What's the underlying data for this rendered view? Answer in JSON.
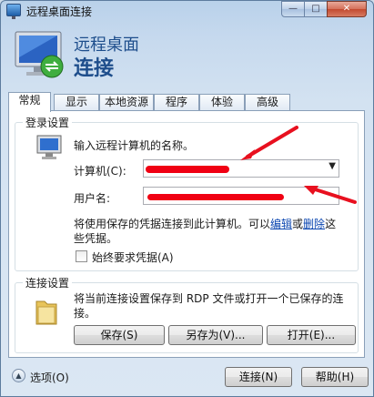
{
  "window": {
    "title": "远程桌面连接",
    "minimize_glyph": "—",
    "maximize_glyph": "□",
    "close_glyph": "✕"
  },
  "header": {
    "line1": "远程桌面",
    "line2": "连接"
  },
  "tabs": [
    {
      "label": "常规",
      "active": true
    },
    {
      "label": "显示",
      "active": false
    },
    {
      "label": "本地资源",
      "active": false
    },
    {
      "label": "程序",
      "active": false
    },
    {
      "label": "体验",
      "active": false
    },
    {
      "label": "高级",
      "active": false
    }
  ],
  "login": {
    "legend": "登录设置",
    "prompt": "输入远程计算机的名称。",
    "computer_label": "计算机(C):",
    "username_label": "用户名:",
    "info_pre": "将使用保存的凭据连接到此计算机。可以",
    "edit_link": "编辑",
    "or_text": "或",
    "delete_link": "删除",
    "info_post": "这",
    "info_line2": "些凭据。",
    "always_ask_label": "始终要求凭据(A)"
  },
  "connection": {
    "legend": "连接设置",
    "desc_line1": "将当前连接设置保存到 RDP 文件或打开一个已保存的连",
    "desc_line2": "接。",
    "save_button": "保存(S)",
    "save_as_button": "另存为(V)...",
    "open_button": "打开(E)..."
  },
  "footer": {
    "options_label": "选项(O)",
    "connect_button": "连接(N)",
    "help_button": "帮助(H)"
  },
  "colors": {
    "accent_header": "#1e4e8c",
    "annotation_red": "#f00013"
  }
}
